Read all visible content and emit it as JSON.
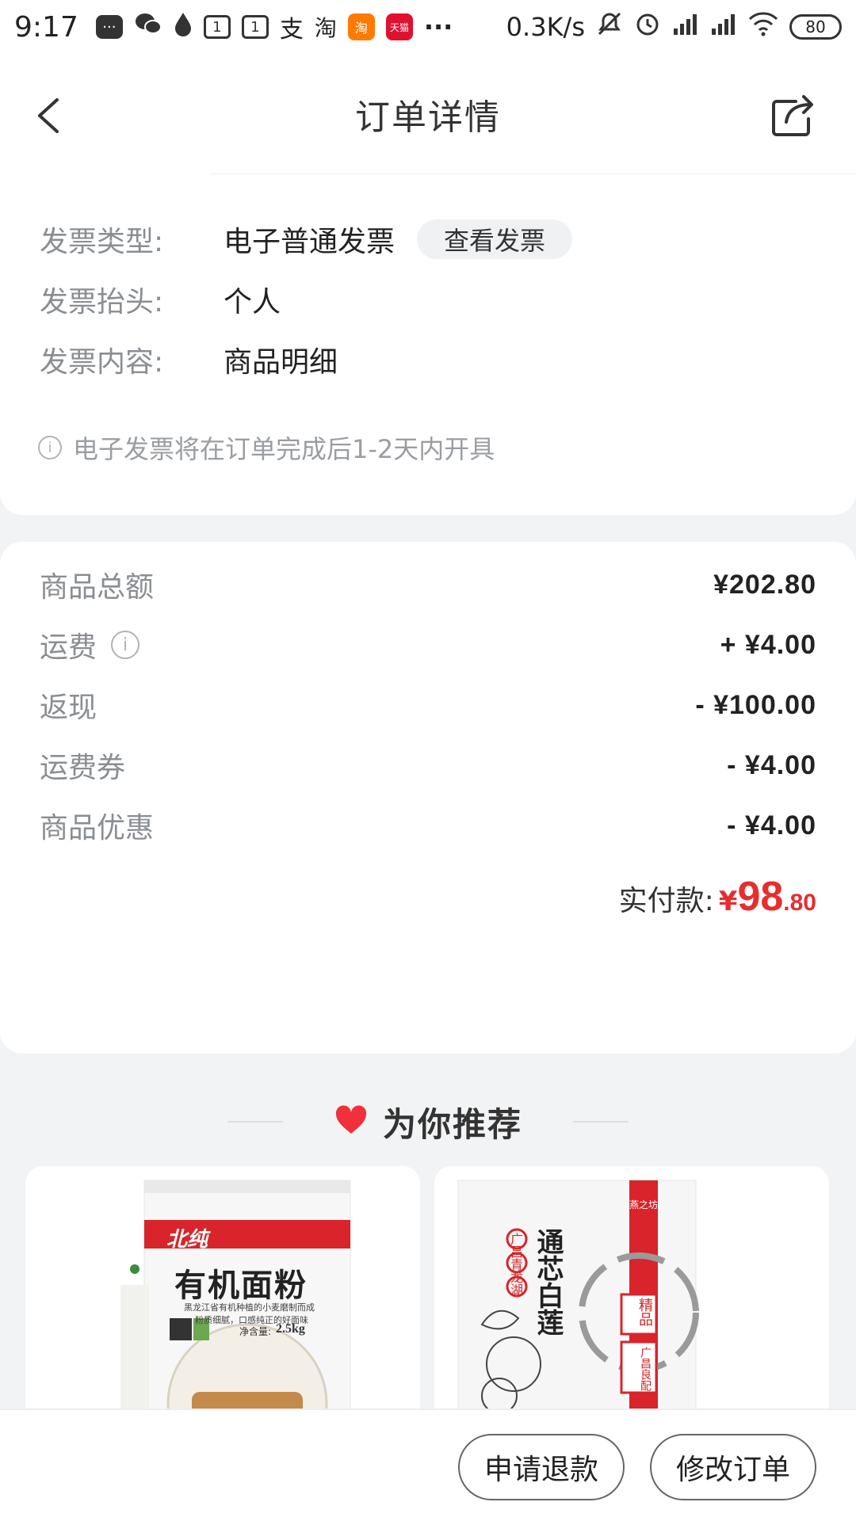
{
  "status_bar": {
    "time": "9:17",
    "app_icons": [
      "message-icon",
      "wechat-icon",
      "drop-icon",
      "calendar-icon",
      "calendar-icon",
      "alipay-icon",
      "taobao-icon",
      "taobao-app-icon",
      "tmall-app-icon"
    ],
    "cal1": "1",
    "cal2": "1",
    "alipay": "支",
    "taobao": "淘",
    "taobao_app": "淘",
    "tmall_app": "天猫",
    "dots": "···",
    "speed": "0.3K/s",
    "battery": "80"
  },
  "header": {
    "title": "订单详情"
  },
  "invoice": {
    "type_label": "发票类型:",
    "type_value": "电子普通发票",
    "view_button": "查看发票",
    "header_label": "发票抬头:",
    "header_value": "个人",
    "content_label": "发票内容:",
    "content_value": "商品明细",
    "note": "电子发票将在订单完成后1-2天内开具"
  },
  "fees": {
    "rows": [
      {
        "label": "商品总额",
        "value": "¥202.80"
      },
      {
        "label": "运费",
        "value": "+ ¥4.00",
        "info": true
      },
      {
        "label": "返现",
        "value": "- ¥100.00"
      },
      {
        "label": "运费券",
        "value": "- ¥4.00"
      },
      {
        "label": "商品优惠",
        "value": "- ¥4.00"
      }
    ],
    "paid_label": "实付款:",
    "paid_currency": "¥",
    "paid_int": "98",
    "paid_dec": ".80"
  },
  "recommend": {
    "title": "为你推荐",
    "products": [
      {
        "brand": "北纯",
        "name": "有机面粉",
        "weight_label": "净含量:",
        "weight": "2.5kg",
        "tagline": "黑龙江省有机种植的小麦磨制而成",
        "tagline2": "粉质细腻，口感纯正的好面味"
      },
      {
        "brand": "燕之坊",
        "name": "通芯白莲",
        "side_text": "广昌青龙湖",
        "stamp": "精品",
        "badge": "广昌良配"
      }
    ]
  },
  "actions": {
    "refund": "申请退款",
    "modify": "修改订单"
  },
  "colors": {
    "accent_red": "#e62e2e",
    "label_gray": "#8a8e92",
    "background": "#f2f3f4"
  }
}
